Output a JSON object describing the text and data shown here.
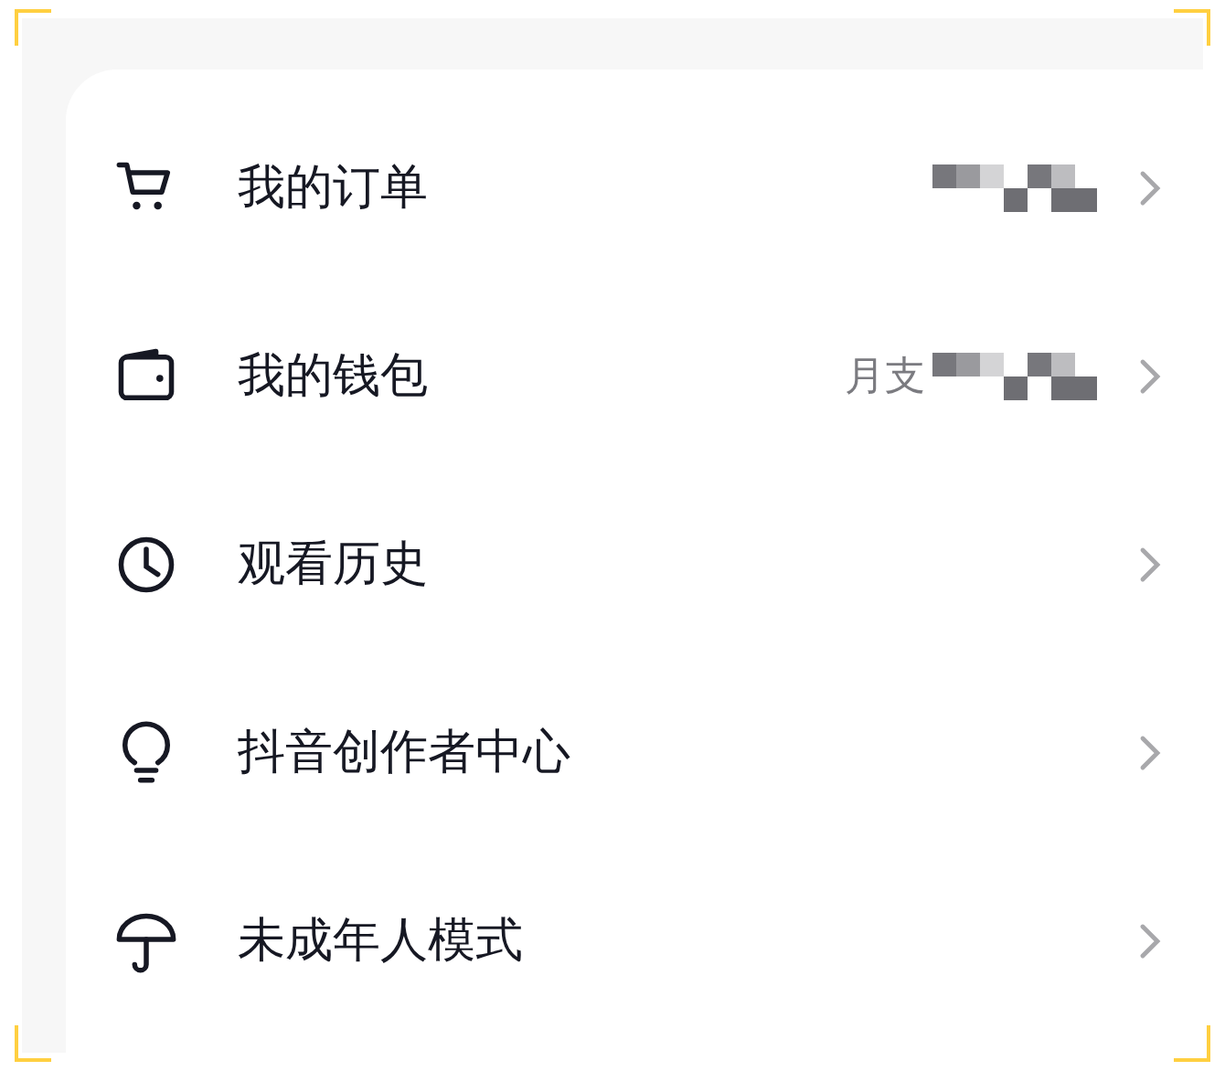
{
  "menu": [
    {
      "kind": "cart",
      "label": "我的订单",
      "redacted": true
    },
    {
      "kind": "wallet",
      "label": "我的钱包",
      "value": "月支",
      "redacted": true
    },
    {
      "kind": "clock",
      "label": "观看历史",
      "redacted": false
    },
    {
      "kind": "bulb",
      "label": "抖音创作者中心",
      "redacted": false
    },
    {
      "kind": "umbrella",
      "label": "未成年人模式",
      "redacted": false
    }
  ]
}
